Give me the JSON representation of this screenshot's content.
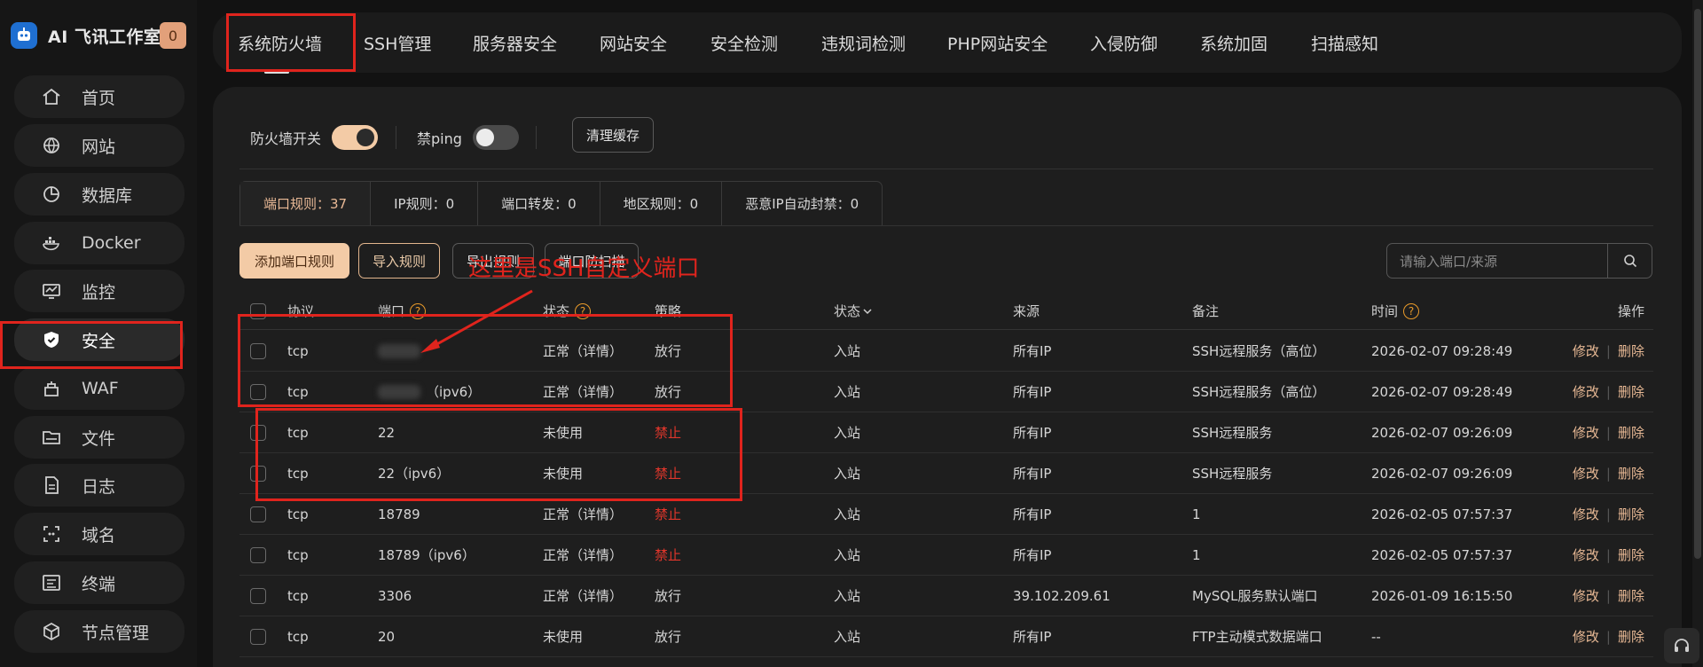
{
  "brand": {
    "name": "AI 飞讯工作室",
    "badge": "0"
  },
  "sidebar": {
    "items": [
      {
        "label": "首页",
        "icon": "home-icon"
      },
      {
        "label": "网站",
        "icon": "globe-icon"
      },
      {
        "label": "数据库",
        "icon": "database-icon"
      },
      {
        "label": "Docker",
        "icon": "docker-icon"
      },
      {
        "label": "监控",
        "icon": "monitor-icon"
      },
      {
        "label": "安全",
        "icon": "shield-icon"
      },
      {
        "label": "WAF",
        "icon": "waf-icon"
      },
      {
        "label": "文件",
        "icon": "folder-icon"
      },
      {
        "label": "日志",
        "icon": "log-icon"
      },
      {
        "label": "域名",
        "icon": "domain-icon"
      },
      {
        "label": "终端",
        "icon": "terminal-icon"
      },
      {
        "label": "节点管理",
        "icon": "cube-icon"
      }
    ],
    "active": "安全"
  },
  "tabs": [
    "系统防火墙",
    "SSH管理",
    "服务器安全",
    "网站安全",
    "安全检测",
    "违规词检测",
    "PHP网站安全",
    "入侵防御",
    "系统加固",
    "扫描感知"
  ],
  "toolbar": {
    "firewall_label": "防火墙开关",
    "firewall_on": true,
    "ping_label": "禁ping",
    "ping_on": false,
    "clear_cache": "清理缓存"
  },
  "stats": [
    {
      "label": "端口规则：37"
    },
    {
      "label": "IP规则：0"
    },
    {
      "label": "端口转发：0"
    },
    {
      "label": "地区规则：0"
    },
    {
      "label": "恶意IP自动封禁：0"
    }
  ],
  "actions": {
    "add_port_rule": "添加端口规则",
    "import_rules": "导入规则",
    "export_rules": "导出规则",
    "port_scan": "端口防扫描"
  },
  "search": {
    "placeholder": "请输入端口/来源"
  },
  "annotation": "这里是SSH自定义端口",
  "table": {
    "headers": {
      "protocol": "协议",
      "port": "端口",
      "status": "状态",
      "policy": "策略",
      "direction": "状态",
      "source": "来源",
      "remark": "备注",
      "time": "时间",
      "ops": "操作"
    },
    "rows": [
      {
        "protocol": "tcp",
        "port": "",
        "port_suffix": "",
        "blurred": true,
        "status": "正常（详情）",
        "policy": "放行",
        "deny": false,
        "direction": "入站",
        "source": "所有IP",
        "remark": "SSH远程服务（高位）",
        "time": "2026-02-07 09:28:49"
      },
      {
        "protocol": "tcp",
        "port": "",
        "port_suffix": "（ipv6）",
        "blurred": true,
        "status": "正常（详情）",
        "policy": "放行",
        "deny": false,
        "direction": "入站",
        "source": "所有IP",
        "remark": "SSH远程服务（高位）",
        "time": "2026-02-07 09:28:49"
      },
      {
        "protocol": "tcp",
        "port": "22",
        "port_suffix": "",
        "blurred": false,
        "status": "未使用",
        "policy": "禁止",
        "deny": true,
        "direction": "入站",
        "source": "所有IP",
        "remark": "SSH远程服务",
        "time": "2026-02-07 09:26:09"
      },
      {
        "protocol": "tcp",
        "port": "22",
        "port_suffix": "（ipv6）",
        "blurred": false,
        "status": "未使用",
        "policy": "禁止",
        "deny": true,
        "direction": "入站",
        "source": "所有IP",
        "remark": "SSH远程服务",
        "time": "2026-02-07 09:26:09"
      },
      {
        "protocol": "tcp",
        "port": "18789",
        "port_suffix": "",
        "blurred": false,
        "status": "正常（详情）",
        "policy": "禁止",
        "deny": true,
        "direction": "入站",
        "source": "所有IP",
        "remark": "1",
        "time": "2026-02-05 07:57:37"
      },
      {
        "protocol": "tcp",
        "port": "18789",
        "port_suffix": "（ipv6）",
        "blurred": false,
        "status": "正常（详情）",
        "policy": "禁止",
        "deny": true,
        "direction": "入站",
        "source": "所有IP",
        "remark": "1",
        "time": "2026-02-05 07:57:37"
      },
      {
        "protocol": "tcp",
        "port": "3306",
        "port_suffix": "",
        "blurred": false,
        "status": "正常（详情）",
        "policy": "放行",
        "deny": false,
        "direction": "入站",
        "source": "39.102.209.61",
        "remark": "MySQL服务默认端口",
        "time": "2026-01-09 16:15:50"
      },
      {
        "protocol": "tcp",
        "port": "20",
        "port_suffix": "",
        "blurred": false,
        "status": "未使用",
        "policy": "放行",
        "deny": false,
        "direction": "入站",
        "source": "所有IP",
        "remark": "FTP主动模式数据端口",
        "time": "--"
      }
    ],
    "op_edit": "修改",
    "op_delete": "删除"
  },
  "colors": {
    "accent": "#f3cba6",
    "deny": "#e0362b",
    "annotation": "#e0241d"
  }
}
